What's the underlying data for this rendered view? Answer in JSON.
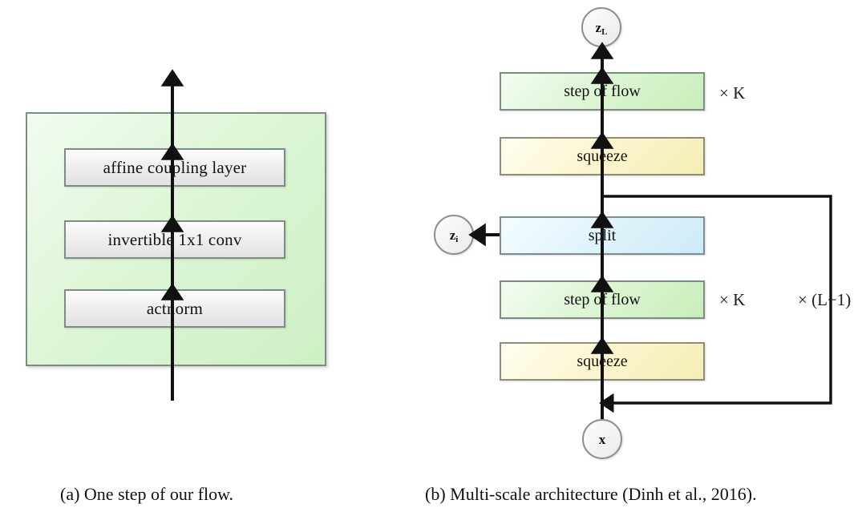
{
  "figure": {
    "panel_a": {
      "caption": "(a) One step of our flow.",
      "container_name": "step-of-flow-container",
      "boxes": [
        {
          "label": "affine coupling layer",
          "color": "#eeeef0",
          "order": 3
        },
        {
          "label": "invertible 1x1 conv",
          "color": "#eeeef0",
          "order": 2
        },
        {
          "label": "actnorm",
          "color": "#eeeef0",
          "order": 1
        }
      ]
    },
    "panel_b": {
      "caption": "(b) Multi-scale architecture (Dinh et al., 2016).",
      "boxes": [
        {
          "label": "step of flow",
          "kind": "green",
          "color": "#d5f3cb"
        },
        {
          "label": "squeeze",
          "kind": "yellow",
          "color": "#f8f1c4"
        },
        {
          "label": "split",
          "kind": "blue",
          "color": "#d9f1fa"
        },
        {
          "label": "step of flow",
          "kind": "green",
          "color": "#d5f3cb"
        },
        {
          "label": "squeeze",
          "kind": "yellow",
          "color": "#f8f1c4"
        }
      ],
      "nodes": [
        {
          "label": "z",
          "subscript": "L",
          "name": "latent-zL"
        },
        {
          "label": "z",
          "subscript": "i",
          "name": "latent-zi"
        },
        {
          "label": "x",
          "subscript": "",
          "name": "input-x"
        }
      ],
      "multiplicities": [
        {
          "label": "× K",
          "applies_to": "step of flow (top)"
        },
        {
          "label": "× K",
          "applies_to": "step of flow (bottom)"
        },
        {
          "label": "× (L−1)",
          "applies_to": "outer loop"
        }
      ]
    },
    "colors": {
      "green_fill": "#d5f3cb",
      "yellow_fill": "#f8f1c4",
      "blue_fill": "#d9f1fa",
      "grey_fill": "#eeeef0",
      "border_grey": "#7e8d84",
      "arrow_black": "#111111",
      "page_background": "#ffffff"
    }
  }
}
